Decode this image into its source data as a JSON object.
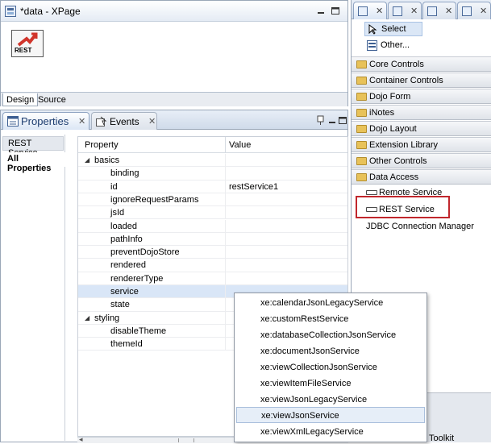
{
  "editor": {
    "title": "*data - XPage",
    "control_label": "REST",
    "tabs": [
      "Design",
      "Source"
    ]
  },
  "properties_panel": {
    "tab_properties": "Properties",
    "tab_events": "Events",
    "left_tabs": [
      "REST Service",
      "All Properties"
    ],
    "grid_headers": {
      "property": "Property",
      "value": "Value"
    },
    "rows": [
      {
        "name": "basics",
        "value": ""
      },
      {
        "name": "binding",
        "value": ""
      },
      {
        "name": "id",
        "value": "restService1"
      },
      {
        "name": "ignoreRequestParams",
        "value": ""
      },
      {
        "name": "jsId",
        "value": ""
      },
      {
        "name": "loaded",
        "value": ""
      },
      {
        "name": "pathInfo",
        "value": ""
      },
      {
        "name": "preventDojoStore",
        "value": ""
      },
      {
        "name": "rendered",
        "value": ""
      },
      {
        "name": "rendererType",
        "value": ""
      },
      {
        "name": "service",
        "value": ""
      },
      {
        "name": "state",
        "value": ""
      },
      {
        "name": "styling",
        "value": ""
      },
      {
        "name": "disableTheme",
        "value": ""
      },
      {
        "name": "themeId",
        "value": ""
      }
    ]
  },
  "palette": {
    "select_label": "Select",
    "other_label": "Other...",
    "drawers": [
      "Core Controls",
      "Container Controls",
      "Dojo Form",
      "iNotes",
      "Dojo Layout",
      "Extension Library",
      "Other Controls",
      "Data Access"
    ],
    "data_access_items": [
      "Remote Service",
      "REST Service",
      "JDBC Connection Manager"
    ],
    "bottom_label": "Toolkit"
  },
  "service_dropdown": {
    "options": [
      "xe:calendarJsonLegacyService",
      "xe:customRestService",
      "xe:databaseCollectionJsonService",
      "xe:documentJsonService",
      "xe:viewCollectionJsonService",
      "xe:viewItemFileService",
      "xe:viewJsonLegacyService",
      "xe:viewJsonService",
      "xe:viewXmlLegacyService"
    ],
    "highlighted": "xe:viewJsonService"
  },
  "colors": {
    "highlight_box": "#c1272d",
    "selection": "#d9e6f7"
  }
}
